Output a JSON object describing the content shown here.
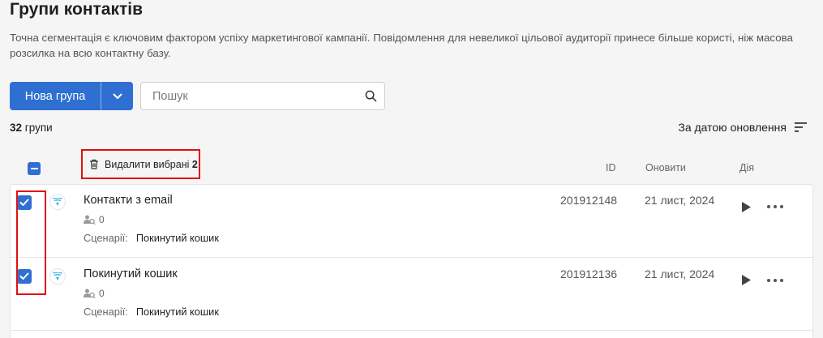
{
  "page": {
    "title": "Групи контактів",
    "description": "Точна сегментація є ключовим фактором успіху маркетингової кампанії. Повідомлення для невеликої цільової аудиторії принесе більше користі, ніж масова розсилка на всю контактну базу."
  },
  "toolbar": {
    "new_group_label": "Нова група",
    "search_placeholder": "Пошук",
    "search_value": ""
  },
  "summary": {
    "count": "32",
    "count_label": "групи",
    "sort_label": "За датою оновлення"
  },
  "bulk_actions": {
    "delete_label": "Видалити вибрані",
    "selected_count": "2"
  },
  "columns": {
    "id": "ID",
    "updated": "Оновити",
    "action": "Дія"
  },
  "groups": [
    {
      "name": "Контакти з email",
      "members": "0",
      "scenario_label": "Сценарії:",
      "scenario": "Покинутий кошик",
      "id": "201912148",
      "updated": "21 лист, 2024",
      "checked": true
    },
    {
      "name": "Покинутий кошик",
      "members": "0",
      "scenario_label": "Сценарії:",
      "scenario": "Покинутий кошик",
      "id": "201912136",
      "updated": "21 лист, 2024",
      "checked": true
    }
  ],
  "colors": {
    "primary": "#2f6fd1",
    "highlight": "#e01010",
    "segment_icon": "#36b5e8",
    "background": "#f5f5f5"
  },
  "icons": {
    "dropdown": "chevron-down-icon",
    "search": "search-icon",
    "sort": "sort-lines-icon",
    "delete": "trash-icon",
    "segment": "filter-funnel-icon",
    "members": "users-search-icon",
    "run": "play-icon",
    "more": "more-dots-icon"
  }
}
